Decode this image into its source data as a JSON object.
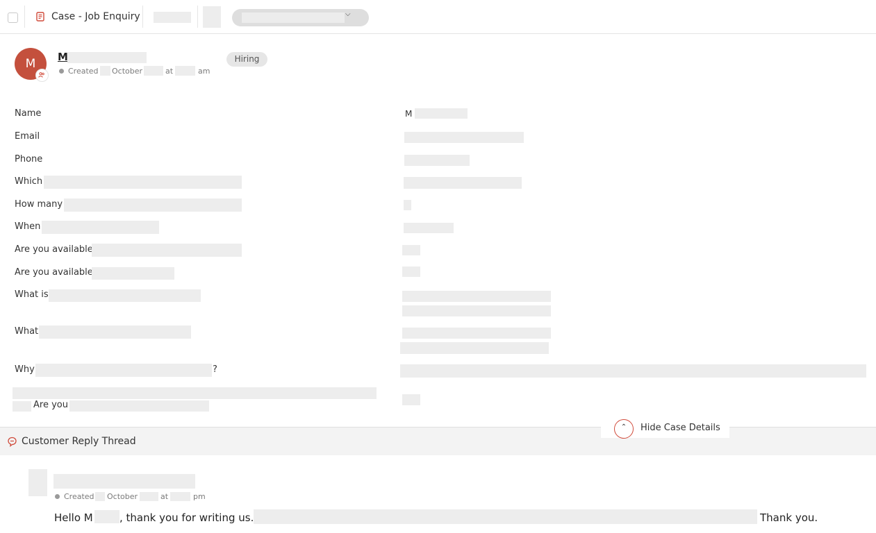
{
  "toolbar": {
    "case_title": "Case - Job Enquiry",
    "doc_icon": "document-icon",
    "dropdown_icon": "chevron-down-icon"
  },
  "case": {
    "avatar_initial": "M",
    "name": "M",
    "created_prefix": "Created",
    "created_month": "October",
    "created_at": "at",
    "created_ampm": "am",
    "badge": "Hiring"
  },
  "fields": [
    {
      "label": "Name",
      "value": "M"
    },
    {
      "label": "Email"
    },
    {
      "label": "Phone"
    },
    {
      "label": "Which"
    },
    {
      "label": "How many"
    },
    {
      "label": "When"
    },
    {
      "label": "Are you available"
    },
    {
      "label": "Are you available"
    },
    {
      "label": "What is"
    },
    {
      "label": "What"
    },
    {
      "label": "Why",
      "suffix": "?"
    },
    {
      "label": "Are you"
    }
  ],
  "hide_details": {
    "label": "Hide Case Details",
    "icon": "chevron-up-icon"
  },
  "thread": {
    "title": "Customer Reply Thread",
    "icon": "chat-bubbles-icon",
    "reply": {
      "created_prefix": "Created",
      "created_month": "October",
      "created_at": "at",
      "created_ampm": "pm",
      "greeting": "Hello M",
      "after_name": ", thank you for writing us.",
      "closing": "Thank you."
    }
  },
  "colors": {
    "accent": "#c4503d",
    "icon_red": "#d04a3a"
  }
}
